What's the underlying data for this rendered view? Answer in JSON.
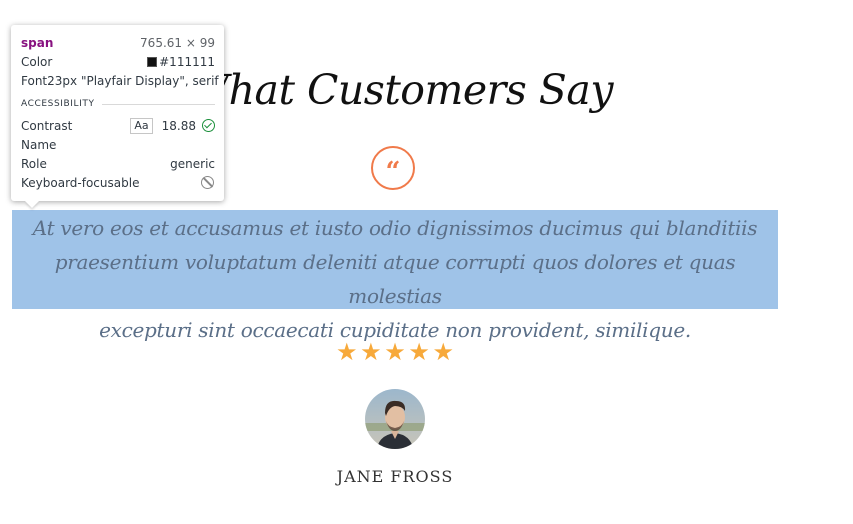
{
  "section": {
    "heading": "What Customers Say"
  },
  "testimonial": {
    "quote_icon": "quote-icon",
    "quote_glyph": "“",
    "line1": "At vero eos et accusamus et iusto odio dignissimos ducimus qui blanditiis",
    "line2": "praesentium voluptatum deleniti atque corrupti quos dolores et quas molestias",
    "line3": "excepturi sint occaecati cupiditate non provident, similique.",
    "rating": 5,
    "rating_max": 5,
    "star_icon": "star-icon",
    "customer_name": "JANE FROSS"
  },
  "inspector": {
    "tag": "span",
    "dimensions": "765.61 × 99",
    "color_label": "Color",
    "color_value": "#111111",
    "font_label": "Font",
    "font_value": "23px \"Playfair Display\", serif",
    "accessibility_header": "ACCESSIBILITY",
    "contrast_label": "Contrast",
    "contrast_aa": "Aa",
    "contrast_value": "18.88",
    "name_label": "Name",
    "name_value": "",
    "role_label": "Role",
    "role_value": "generic",
    "focusable_label": "Keyboard-focusable"
  },
  "colors": {
    "accent": "#f07a4a",
    "star": "#f7a93a",
    "highlight": "#9fc3e8",
    "text": "#111111"
  }
}
